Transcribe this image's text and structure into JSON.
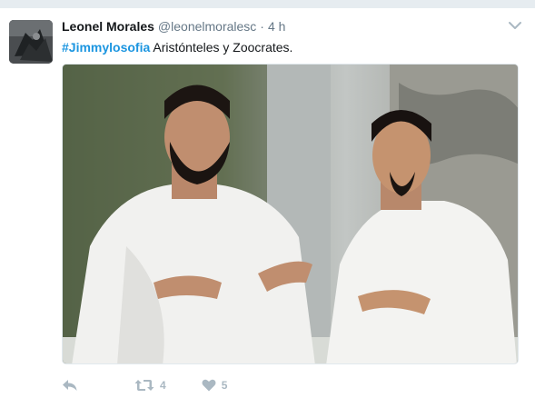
{
  "tweet": {
    "author_name": "Leonel Morales",
    "handle": "@leonelmoralesc",
    "separator": "·",
    "time": "4 h",
    "hashtag": "#Jimmylosofia",
    "text": " Aristónteles y Zoocrates.",
    "retweet_count": "4",
    "like_count": "5"
  },
  "colors": {
    "hashtag": "#1b95e0",
    "secondary_text": "#657786",
    "action_icons": "#aab8c2"
  },
  "icons": {
    "reply": "reply-icon",
    "retweet": "retweet-icon",
    "like": "heart-icon",
    "menu": "chevron-down-icon"
  }
}
